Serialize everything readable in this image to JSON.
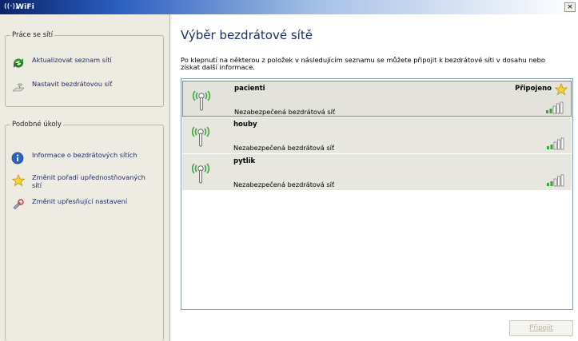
{
  "window": {
    "title": "WiFi",
    "close_glyph": "×"
  },
  "left_pane": {
    "network_tasks": {
      "title": "Práce se sítí",
      "items": [
        {
          "label": "Aktualizovat seznam sítí",
          "icon": "refresh-icon"
        },
        {
          "label": "Nastavit bezdrátovou síť",
          "icon": "wireless-setup-icon"
        }
      ]
    },
    "related_tasks": {
      "title": "Podobné úkoly",
      "items": [
        {
          "label": "Informace o bezdrátových sítích",
          "icon": "info-icon"
        },
        {
          "label": "Změnit pořadí upřednostňovaných sítí",
          "icon": "star-icon"
        },
        {
          "label": "Změnit upřesňující nastavení",
          "icon": "settings-icon"
        }
      ]
    }
  },
  "main": {
    "title": "Výběr bezdrátové sítě",
    "instructions": "Po klepnutí na některou z položek v následujícím seznamu se můžete připojit k bezdrátové síti v dosahu nebo získat další informace.",
    "networks": [
      {
        "name": "pacienti",
        "security": "Nezabezpečená bezdrátová síť",
        "status": "Připojeno",
        "signal_bars": 5,
        "selected": true
      },
      {
        "name": "houby",
        "security": "Nezabezpečená bezdrátová síť",
        "status": "",
        "signal_bars": 5,
        "selected": false
      },
      {
        "name": "pytlik",
        "security": "Nezabezpečená bezdrátová síť",
        "status": "",
        "signal_bars": 5,
        "selected": false
      }
    ],
    "connect_button": "Připojit"
  },
  "colors": {
    "title_gradient_start": "#0a246a",
    "left_pane_bg": "#eeece2",
    "signal_green": "#3ca43c",
    "listbox_border": "#7f9db9"
  }
}
